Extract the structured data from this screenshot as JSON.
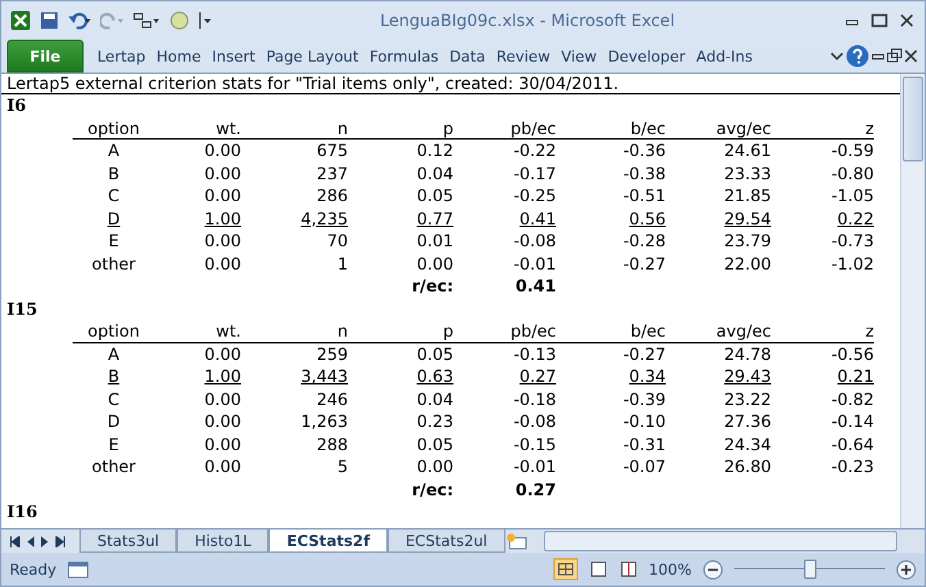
{
  "window": {
    "title": "LenguaBIg09c.xlsx - Microsoft Excel"
  },
  "file_button": "File",
  "ribbon_tabs": [
    "Lertap",
    "Home",
    "Insert",
    "Page Layout",
    "Formulas",
    "Data",
    "Review",
    "View",
    "Developer",
    "Add-Ins"
  ],
  "sheet": {
    "heading": "Lertap5 external criterion stats for \"Trial items only\", created: 30/04/2011.",
    "sections": [
      {
        "item": "I6",
        "columns": [
          "option",
          "wt.",
          "n",
          "p",
          "pb/ec",
          "b/ec",
          "avg/ec",
          "z"
        ],
        "rows": [
          {
            "cells": [
              "A",
              "0.00",
              "675",
              "0.12",
              "-0.22",
              "-0.36",
              "24.61",
              "-0.59"
            ],
            "keyed": false
          },
          {
            "cells": [
              "B",
              "0.00",
              "237",
              "0.04",
              "-0.17",
              "-0.38",
              "23.33",
              "-0.80"
            ],
            "keyed": false
          },
          {
            "cells": [
              "C",
              "0.00",
              "286",
              "0.05",
              "-0.25",
              "-0.51",
              "21.85",
              "-1.05"
            ],
            "keyed": false
          },
          {
            "cells": [
              "D",
              "1.00",
              "4,235",
              "0.77",
              "0.41",
              "0.56",
              "29.54",
              "0.22"
            ],
            "keyed": true
          },
          {
            "cells": [
              "E",
              "0.00",
              "70",
              "0.01",
              "-0.08",
              "-0.28",
              "23.79",
              "-0.73"
            ],
            "keyed": false
          },
          {
            "cells": [
              "other",
              "0.00",
              "1",
              "0.00",
              "-0.01",
              "-0.27",
              "22.00",
              "-1.02"
            ],
            "keyed": false
          }
        ],
        "r_label": "r/ec:",
        "r_value": "0.41"
      },
      {
        "item": "I15",
        "columns": [
          "option",
          "wt.",
          "n",
          "p",
          "pb/ec",
          "b/ec",
          "avg/ec",
          "z"
        ],
        "rows": [
          {
            "cells": [
              "A",
              "0.00",
              "259",
              "0.05",
              "-0.13",
              "-0.27",
              "24.78",
              "-0.56"
            ],
            "keyed": false
          },
          {
            "cells": [
              "B",
              "1.00",
              "3,443",
              "0.63",
              "0.27",
              "0.34",
              "29.43",
              "0.21"
            ],
            "keyed": true
          },
          {
            "cells": [
              "C",
              "0.00",
              "246",
              "0.04",
              "-0.18",
              "-0.39",
              "23.22",
              "-0.82"
            ],
            "keyed": false
          },
          {
            "cells": [
              "D",
              "0.00",
              "1,263",
              "0.23",
              "-0.08",
              "-0.10",
              "27.36",
              "-0.14"
            ],
            "keyed": false
          },
          {
            "cells": [
              "E",
              "0.00",
              "288",
              "0.05",
              "-0.15",
              "-0.31",
              "24.34",
              "-0.64"
            ],
            "keyed": false
          },
          {
            "cells": [
              "other",
              "0.00",
              "5",
              "0.00",
              "-0.01",
              "-0.07",
              "26.80",
              "-0.23"
            ],
            "keyed": false
          }
        ],
        "r_label": "r/ec:",
        "r_value": "0.27"
      }
    ],
    "partial_item": "I16"
  },
  "sheet_tabs": [
    {
      "label": "Stats3ul",
      "selected": false
    },
    {
      "label": "Histo1L",
      "selected": false
    },
    {
      "label": "ECStats2f",
      "selected": true
    },
    {
      "label": "ECStats2ul",
      "selected": false
    }
  ],
  "status_bar": {
    "mode": "Ready",
    "zoom": "100%",
    "zoom_slider": {
      "level": 0.5
    }
  }
}
